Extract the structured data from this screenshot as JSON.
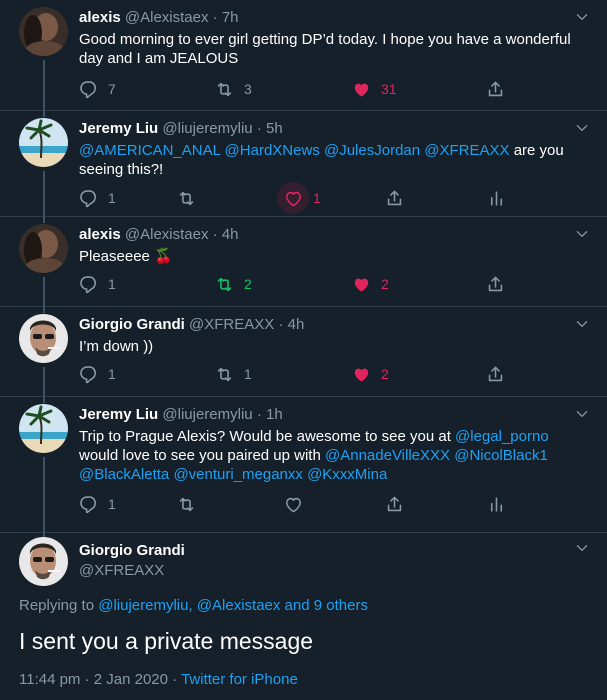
{
  "tweets": [
    {
      "name": "alexis",
      "handle": "@Alexistaex",
      "time": "7h",
      "text": "Good morning to ever girl getting DP’d today. I hope you have a wonderful day and I am JEALOUS",
      "reply_count": "7",
      "retweet_count": "3",
      "like_count": "31",
      "liked": true
    },
    {
      "name": "Jeremy Liu",
      "handle": "@liujeremyliu",
      "time": "5h",
      "mentions": [
        "@AMERICAN_ANAL",
        "@HardXNews",
        "@JulesJordan",
        "@XFREAXX"
      ],
      "text_after": "are you seeing this?!",
      "reply_count": "1",
      "retweet_count": "",
      "like_count": "1",
      "liked": false
    },
    {
      "name": "alexis",
      "handle": "@Alexistaex",
      "time": "4h",
      "text": "Pleaseeee 🍒",
      "reply_count": "1",
      "retweet_count": "2",
      "like_count": "2",
      "liked": true,
      "retweeted": true
    },
    {
      "name": "Giorgio Grandi",
      "handle": "@XFREAXX",
      "time": "4h",
      "text": "I’m down ))",
      "reply_count": "1",
      "retweet_count": "1",
      "like_count": "2",
      "liked": true
    },
    {
      "name": "Jeremy Liu",
      "handle": "@liujeremyliu",
      "time": "1h",
      "text_1": "Trip to Prague Alexis? Would be awesome to see you at",
      "mention_1": "@legal_porno",
      "text_2": "would love to see you paired up with",
      "mentions_tail": [
        "@AnnadeVilleXXX",
        "@NicolBlack1",
        "@BlackAletta",
        "@venturi_meganxx",
        "@KxxxMina"
      ],
      "reply_count": "1",
      "retweet_count": "",
      "like_count": "",
      "liked": false
    }
  ],
  "focused": {
    "name": "Giorgio Grandi",
    "handle": "@XFREAXX",
    "replying_prefix": "Replying to",
    "replying_users": "@liujeremyliu, @Alexistaex and 9 others",
    "text": "I sent you a private message",
    "timestamp": "11:44 pm · 2 Jan 2020 ·",
    "source": "Twitter for iPhone"
  },
  "icons": [
    "reply-icon",
    "retweet-icon",
    "like-icon",
    "share-icon",
    "analytics-icon",
    "chevron-down-icon"
  ],
  "colors": {
    "background": "#15202b",
    "text": "#ffffff",
    "secondary": "#8899a6",
    "link": "#1da1f2",
    "like": "#e0245e",
    "retweet": "#17bf63"
  }
}
